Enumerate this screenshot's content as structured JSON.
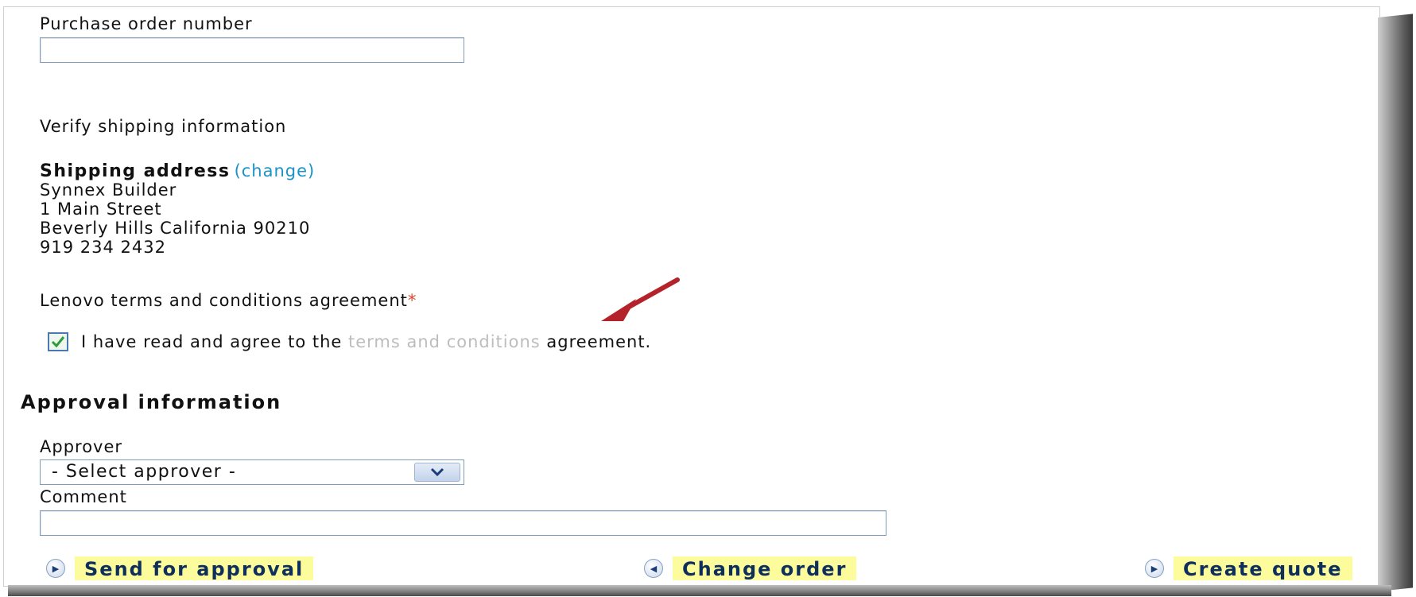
{
  "form": {
    "po_label": "Purchase order number",
    "po_value": "",
    "verify_heading": "Verify shipping information",
    "shipping_label": "Shipping address",
    "change_link": "(change)",
    "address": {
      "line1": "Synnex Builder",
      "line2": "1 Main Street",
      "line3": "Beverly Hills California 90210",
      "phone": "919 234 2432"
    },
    "terms_heading": "Lenovo terms and conditions agreement",
    "required_mark": "*",
    "agree_prefix": "I have read and agree to the",
    "agree_link": "terms and conditions",
    "agree_suffix": "agreement.",
    "agree_checked": true
  },
  "approval": {
    "section_title": "Approval information",
    "approver_label": "Approver",
    "approver_selected": "- Select approver -",
    "comment_label": "Comment",
    "comment_value": ""
  },
  "buttons": {
    "send": "Send for approval",
    "change": "Change order",
    "quote": "Create quote"
  },
  "colors": {
    "link": "#1c93c5",
    "button_highlight": "#fcfc9c",
    "annotation_arrow": "#b5232a"
  }
}
